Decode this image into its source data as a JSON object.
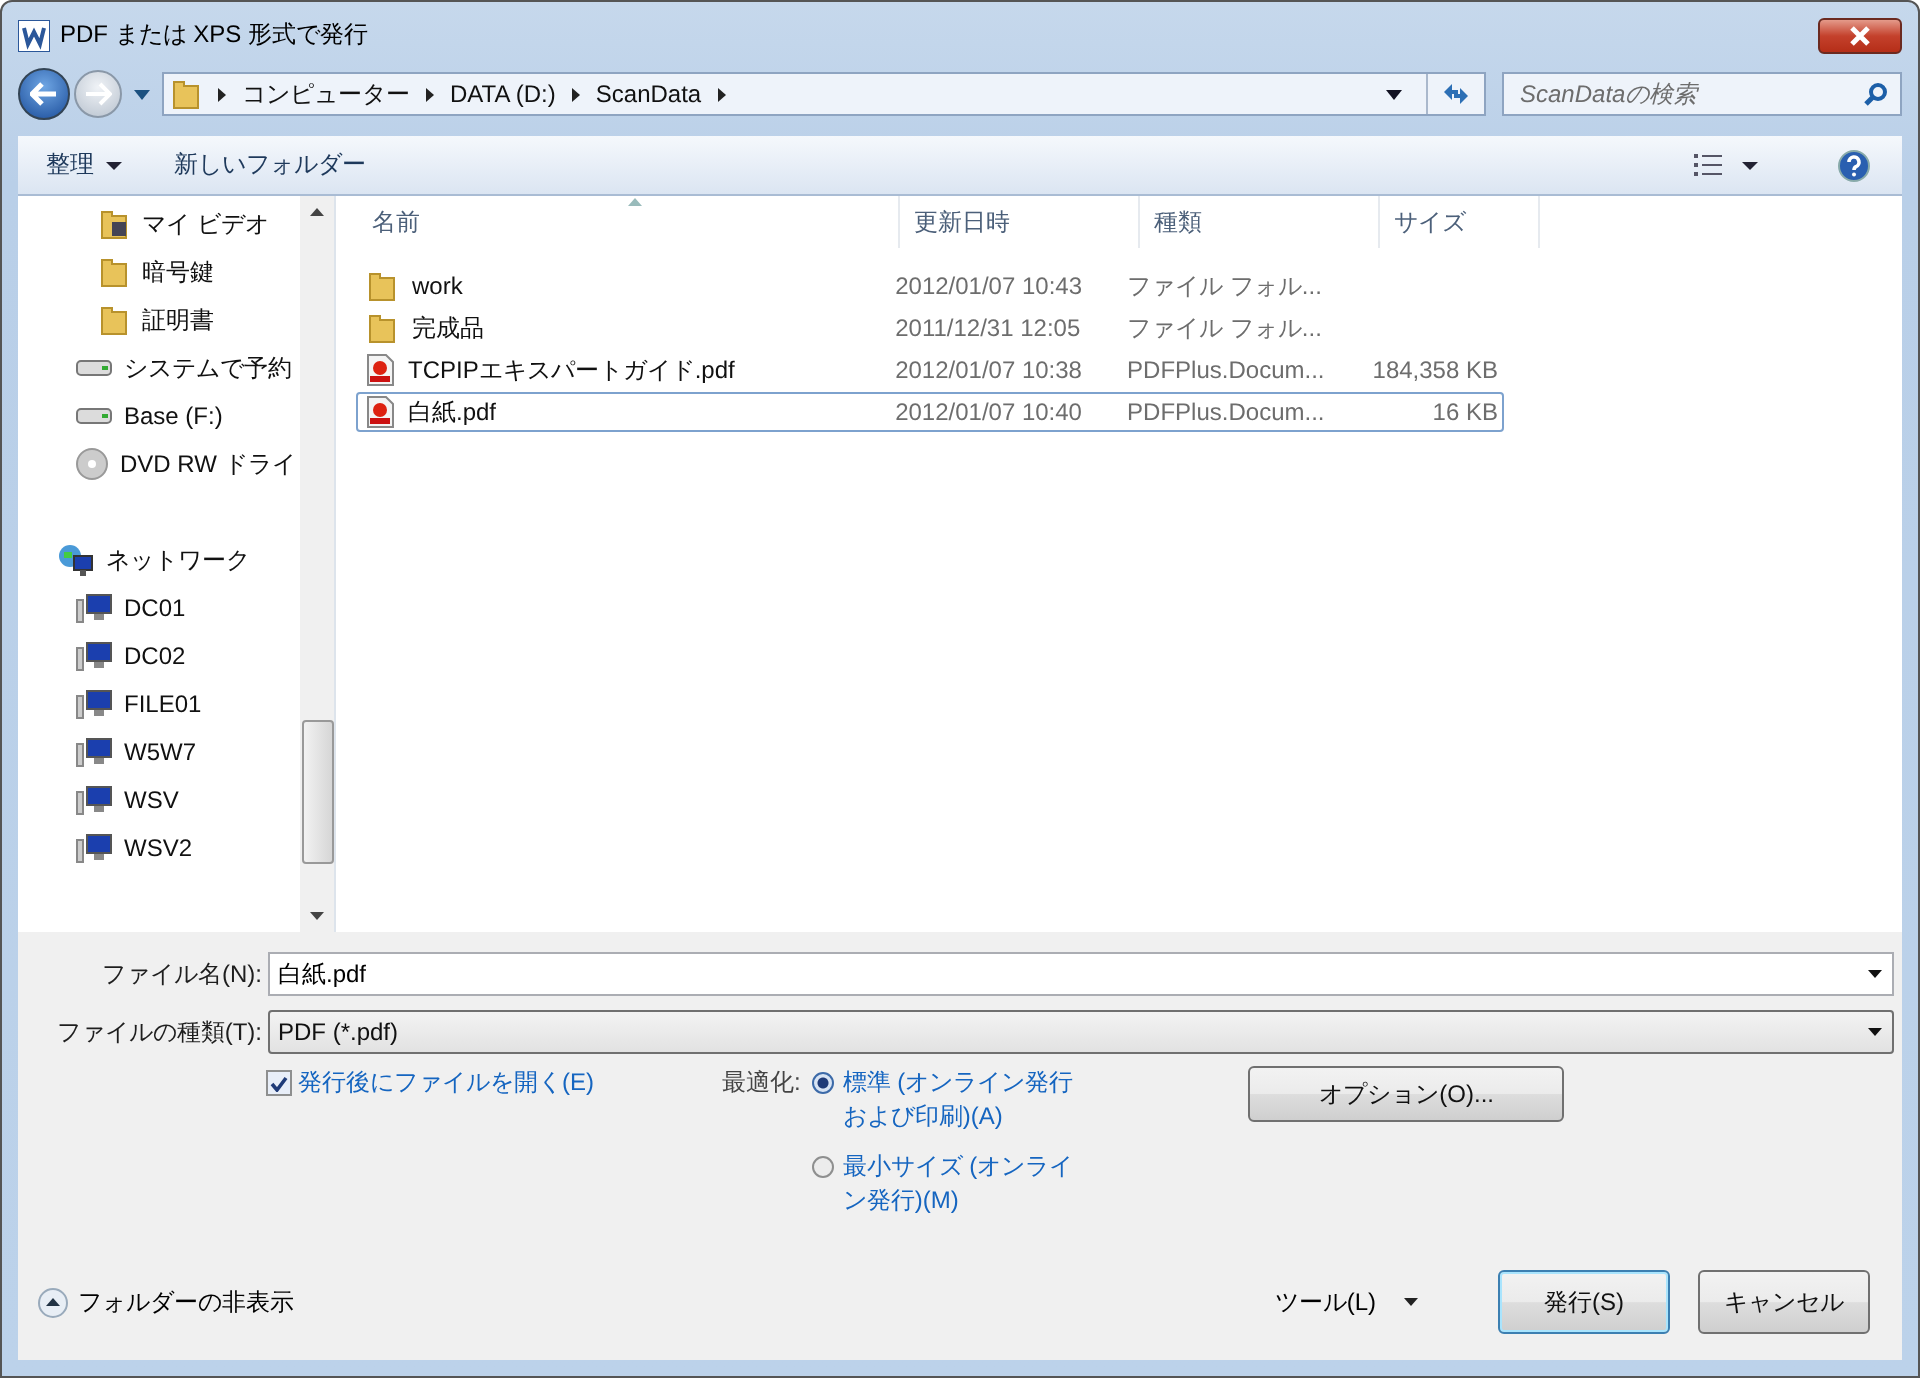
{
  "window": {
    "title": "PDF または XPS 形式で発行"
  },
  "breadcrumb": [
    "コンピューター",
    "DATA (D:)",
    "ScanData"
  ],
  "search": {
    "placeholder": "ScanDataの検索"
  },
  "toolbar": {
    "organize": "整理",
    "new_folder": "新しいフォルダー"
  },
  "sidebar": {
    "items": [
      {
        "label": "マイ ビデオ",
        "kind": "video"
      },
      {
        "label": "暗号鍵",
        "kind": "folder"
      },
      {
        "label": "証明書",
        "kind": "folder"
      },
      {
        "label": "システムで予約",
        "kind": "drive"
      },
      {
        "label": "Base (F:)",
        "kind": "drive"
      },
      {
        "label": "DVD RW ドライ",
        "kind": "dvd"
      },
      {
        "label": "ネットワーク",
        "kind": "network",
        "children": [
          {
            "label": "DC01",
            "kind": "computer"
          },
          {
            "label": "DC02",
            "kind": "computer"
          },
          {
            "label": "FILE01",
            "kind": "computer"
          },
          {
            "label": "W5W7",
            "kind": "computer"
          },
          {
            "label": "WSV",
            "kind": "computer"
          },
          {
            "label": "WSV2",
            "kind": "computer"
          }
        ]
      }
    ]
  },
  "table": {
    "columns": [
      "名前",
      "更新日時",
      "種類",
      "サイズ"
    ],
    "rows": [
      {
        "kind": "folder",
        "name": "work",
        "date": "2012/01/07 10:43",
        "type": "ファイル フォル...",
        "size": "",
        "selected": false
      },
      {
        "kind": "folder",
        "name": "完成品",
        "date": "2011/12/31 12:05",
        "type": "ファイル フォル...",
        "size": "",
        "selected": false
      },
      {
        "kind": "pdf",
        "name": "TCPIPエキスパートガイド.pdf",
        "date": "2012/01/07 10:38",
        "type": "PDFPlus.Docum...",
        "size": "184,358 KB",
        "selected": false
      },
      {
        "kind": "pdf",
        "name": "白紙.pdf",
        "date": "2012/01/07 10:40",
        "type": "PDFPlus.Docum...",
        "size": "16 KB",
        "selected": true
      }
    ]
  },
  "file_name": {
    "label": "ファイル名(N):",
    "value": "白紙.pdf"
  },
  "file_type": {
    "label": "ファイルの種類(T):",
    "value": "PDF (*.pdf)"
  },
  "open_after": {
    "label": "発行後にファイルを開く(E)",
    "checked": true
  },
  "optimize": {
    "label": "最適化:",
    "options": [
      {
        "label": "標準 (オンライン発行および印刷)(A)",
        "selected": true
      },
      {
        "label": "最小サイズ (オンライン発行)(M)",
        "selected": false
      }
    ]
  },
  "options_button": "オプション(O)...",
  "hide_folders": "フォルダーの非表示",
  "tools": "ツール(L)",
  "buttons": [
    "発行(S)",
    "キャンセル"
  ]
}
